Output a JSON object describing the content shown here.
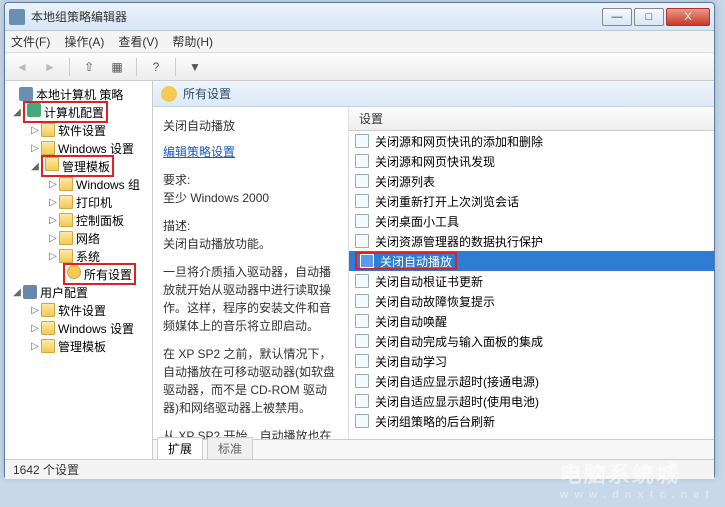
{
  "window": {
    "title": "本地组策略编辑器",
    "min": "—",
    "max": "□",
    "close": "X"
  },
  "menu": {
    "file": "文件(F)",
    "action": "操作(A)",
    "view": "查看(V)",
    "help": "帮助(H)"
  },
  "tree": {
    "root": "本地计算机 策略",
    "computer": "计算机配置",
    "software1": "软件设置",
    "windows_settings": "Windows 设置",
    "admin_templates": "管理模板",
    "windows_components": "Windows 组",
    "printers": "打印机",
    "control_panel": "控制面板",
    "network": "网络",
    "system": "系统",
    "all_settings": "所有设置",
    "user": "用户配置",
    "software2": "软件设置",
    "windows_settings2": "Windows 设置",
    "admin_templates2": "管理模板"
  },
  "header": {
    "title": "所有设置"
  },
  "detail": {
    "title": "关闭自动播放",
    "edit_link": "编辑策略设置",
    "req_label": "要求:",
    "req_value": "至少 Windows 2000",
    "desc_label": "描述:",
    "desc1": "关闭自动播放功能。",
    "desc2": "一旦将介质插入驱动器，自动播放就开始从驱动器中进行读取操作。这样，程序的安装文件和音频媒体上的音乐将立即启动。",
    "desc3": "在 XP SP2 之前，默认情况下，自动播放在可移动驱动器(如软盘驱动器，而不是 CD-ROM 驱动器)和网络驱动器上被禁用。",
    "desc4": "从 XP SP2 开始，自动播放也在可"
  },
  "list": {
    "column": "设置",
    "items": [
      "关闭源和网页快讯的添加和删除",
      "关闭源和网页快讯发现",
      "关闭源列表",
      "关闭重新打开上次浏览会话",
      "关闭桌面小工具",
      "关闭资源管理器的数据执行保护",
      "关闭自动播放",
      "关闭自动根证书更新",
      "关闭自动故障恢复提示",
      "关闭自动唤醒",
      "关闭自动完成与输入面板的集成",
      "关闭自动学习",
      "关闭自适应显示超时(接通电源)",
      "关闭自适应显示超时(使用电池)",
      "关闭组策略的后台刷新"
    ],
    "selected_index": 6
  },
  "tabs": {
    "extended": "扩展",
    "standard": "标准"
  },
  "status": {
    "text": "1642 个设置"
  },
  "watermark": {
    "main": "电脑系统城",
    "sub": "www.dnxtc.net"
  }
}
